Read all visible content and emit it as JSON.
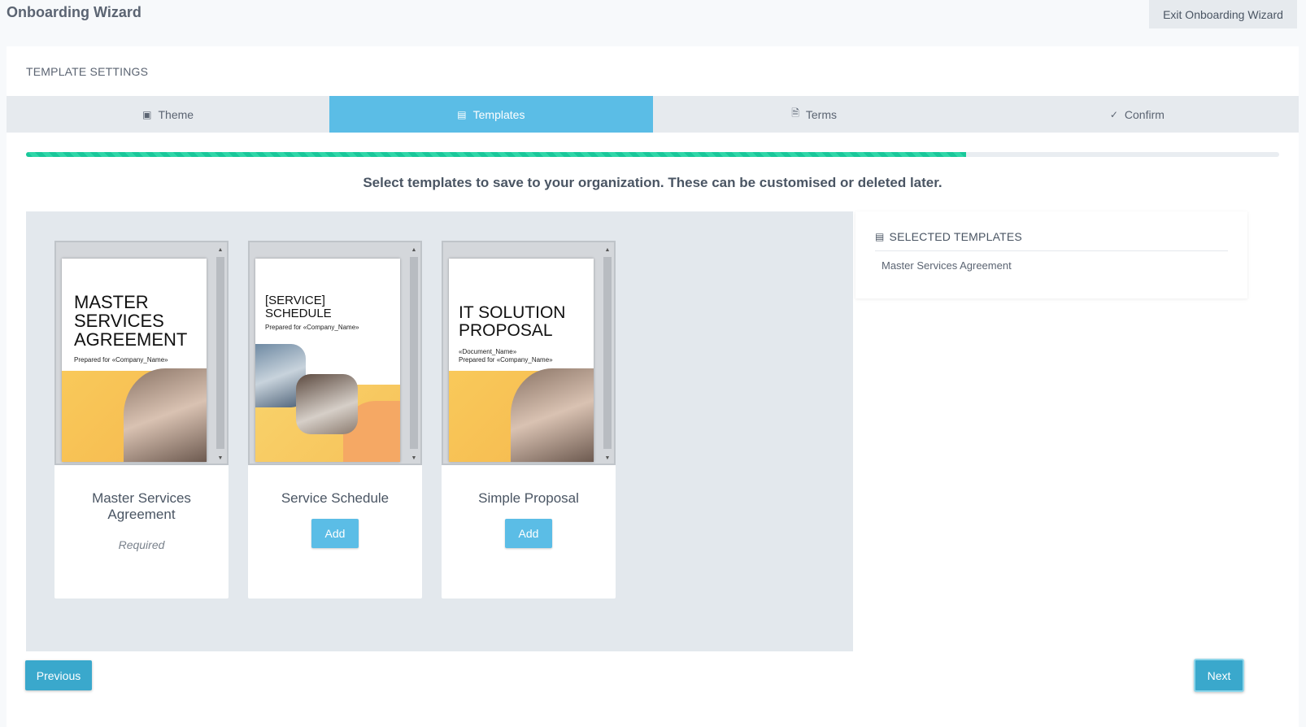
{
  "header": {
    "app_title": "Onboarding Wizard",
    "exit_label": "Exit Onboarding Wizard"
  },
  "section": {
    "title": "TEMPLATE SETTINGS"
  },
  "tabs": [
    {
      "label": "Theme",
      "icon": "image-icon",
      "active": false
    },
    {
      "label": "Templates",
      "icon": "templates-icon",
      "active": true
    },
    {
      "label": "Terms",
      "icon": "document-icon",
      "active": false
    },
    {
      "label": "Confirm",
      "icon": "check-circle-icon",
      "active": false
    }
  ],
  "progress": {
    "percent": 75
  },
  "instruction": "Select templates to save to your organization. These can be customised or deleted later.",
  "templates": [
    {
      "name_line1": "Master Services",
      "name_line2": "Agreement",
      "status": "Required",
      "preview_title": [
        "MASTER",
        "SERVICES",
        "AGREEMENT"
      ],
      "preview_sub": "Prepared for «Company_Name»"
    },
    {
      "name_line1": "Service Schedule",
      "action_label": "Add",
      "preview_title": [
        "[SERVICE]",
        "SCHEDULE"
      ],
      "preview_sub": "Prepared for «Company_Name»"
    },
    {
      "name_line1": "Simple Proposal",
      "action_label": "Add",
      "preview_title": [
        "IT SOLUTION",
        "PROPOSAL"
      ],
      "preview_sub1": "«Document_Name»",
      "preview_sub": "Prepared for «Company_Name»"
    }
  ],
  "selected": {
    "title": "SELECTED TEMPLATES",
    "items": [
      "Master Services Agreement"
    ]
  },
  "footer": {
    "previous_label": "Previous",
    "next_label": "Next"
  },
  "colors": {
    "accent": "#5bbde6",
    "button": "#3aa8cc",
    "progress": "#19c79a"
  }
}
